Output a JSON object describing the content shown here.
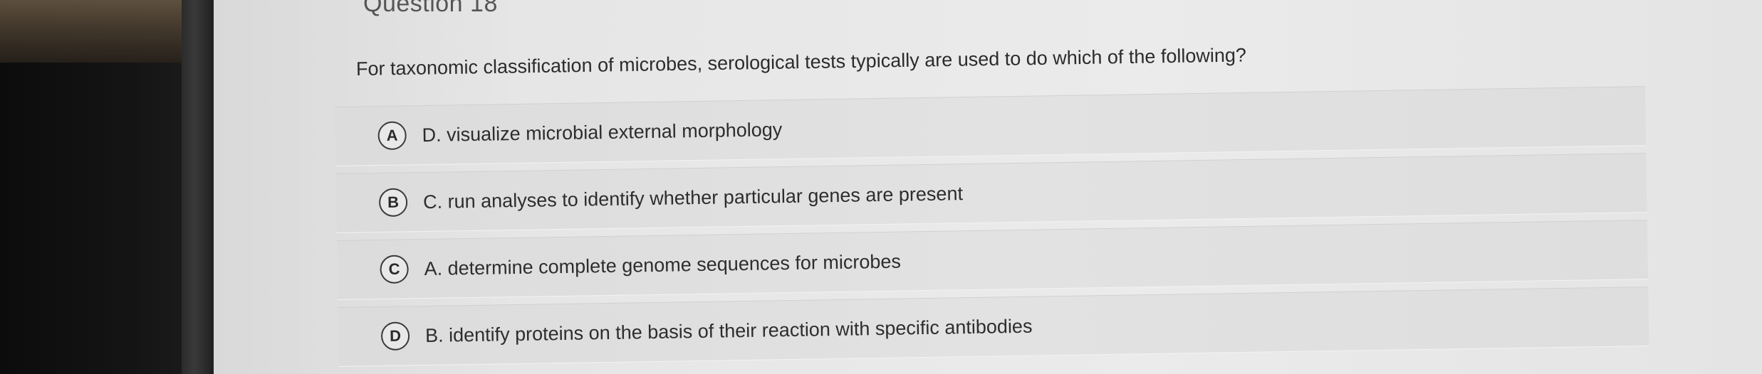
{
  "question": {
    "header": "Question 18",
    "text": "For taxonomic classification of microbes, serological tests typically are used to do which of the following?"
  },
  "answers": [
    {
      "letter": "A",
      "text": "D. visualize microbial external morphology"
    },
    {
      "letter": "B",
      "text": "C. run analyses to identify whether particular genes are present"
    },
    {
      "letter": "C",
      "text": "A. determine complete genome sequences for microbes"
    },
    {
      "letter": "D",
      "text": "B. identify proteins on the basis of their reaction with specific antibodies"
    }
  ]
}
